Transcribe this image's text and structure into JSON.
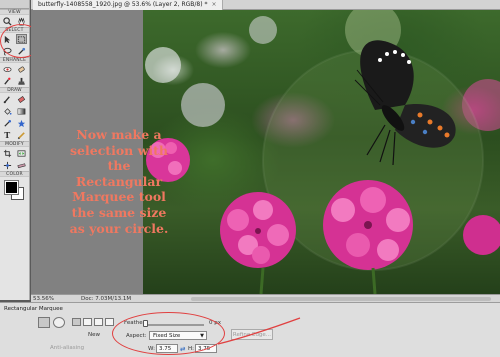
{
  "document": {
    "tab_title": "butterfly-1408558_1920.jpg @ 53.6% (Layer 2, RGB/8) *",
    "tab_close": "×"
  },
  "toolbox": {
    "sections": [
      "VIEW",
      "SELECT",
      "ENHANCE",
      "DRAW",
      "MODIFY",
      "COLOR"
    ],
    "active_tool": "rectangular-marquee"
  },
  "annotation": {
    "text": "Now make a selection with the Rectangular Marquee tool the same size as your circle.",
    "color": "#f07860"
  },
  "status_bar": {
    "zoom": "53.56%",
    "doc_info": "Doc: 7.03M/13.1M"
  },
  "options_bar": {
    "tool_name": "Rectangular Marquee",
    "new_label": "New",
    "feather_label": "Feather:",
    "feather_value": "0 px",
    "feather_level": 0,
    "aspect_label": "Aspect:",
    "aspect_value": "Fixed Size",
    "width_label": "W:",
    "width_value": "3.75",
    "height_label": "H:",
    "height_value": "3.75",
    "refine_edge": "Refine Edge...",
    "anti_aliasing": "Anti-aliasing"
  }
}
